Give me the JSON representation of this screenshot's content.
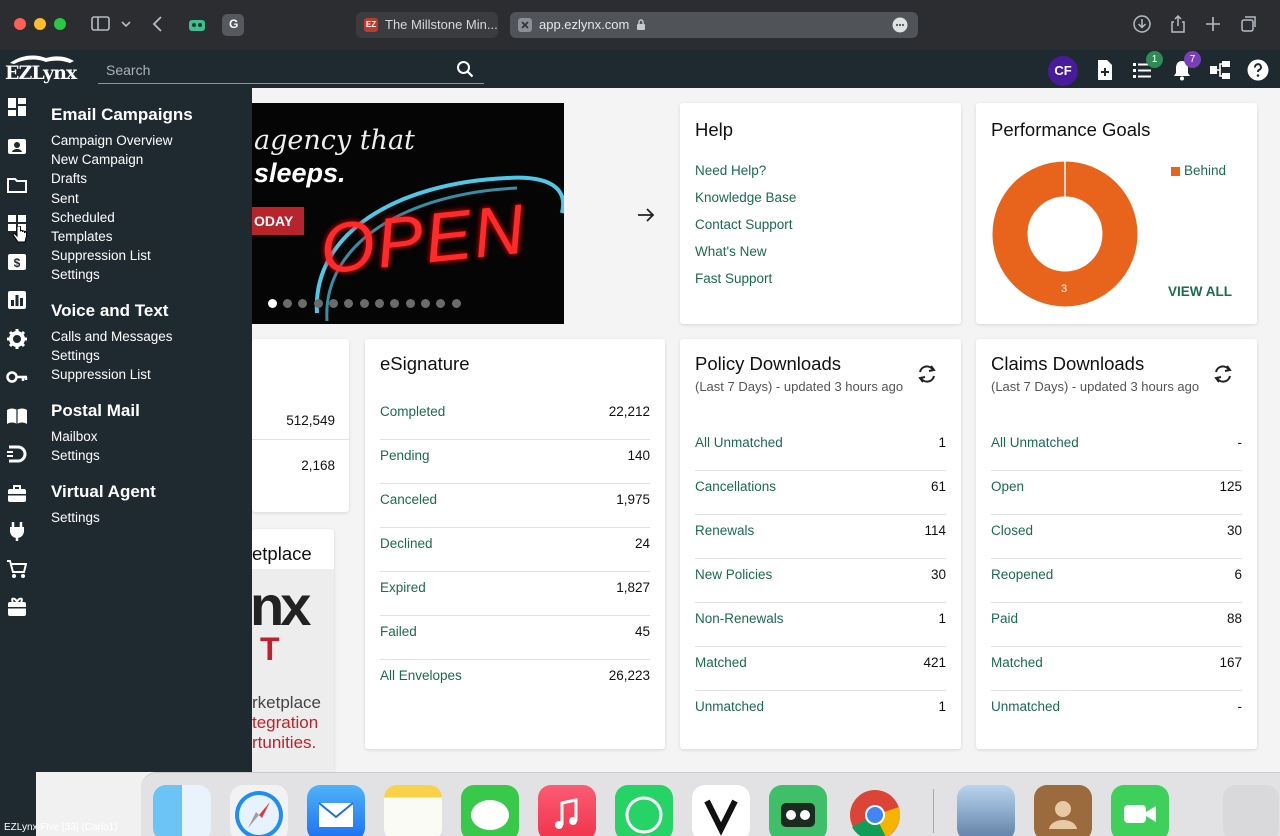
{
  "browser": {
    "tab1_title": "The Millstone Min...",
    "tab1_favicon": "EZ",
    "address": "app.ezlynx.com",
    "ext_label": "G"
  },
  "header": {
    "logo": "EZLynx",
    "search_placeholder": "Search",
    "avatar_initials": "CF",
    "list_badge": "1",
    "notif_badge": "7"
  },
  "menu": {
    "sections": [
      {
        "title": "Email Campaigns",
        "items": [
          "Campaign Overview",
          "New Campaign",
          "Drafts",
          "Sent",
          "Scheduled",
          "Templates",
          "Suppression List",
          "Settings"
        ]
      },
      {
        "title": "Voice and Text",
        "items": [
          "Calls and Messages",
          "Settings",
          "Suppression List"
        ]
      },
      {
        "title": "Postal Mail",
        "items": [
          "Mailbox",
          "Settings"
        ]
      },
      {
        "title": "Virtual Agent",
        "items": [
          "Settings"
        ]
      }
    ]
  },
  "banner": {
    "line1": "agency that",
    "line2": "sleeps.",
    "button": "ODAY",
    "neon": "OPEN"
  },
  "left_stats": {
    "values": [
      "512,549",
      "2,168"
    ],
    "marketplace_title": "etplace",
    "mp_big": "nx",
    "mp_sub": "T",
    "mp_line1": "rketplace",
    "mp_line2": "tegration",
    "mp_line3": "rtunities."
  },
  "help": {
    "title": "Help",
    "links": [
      "Need Help?",
      "Knowledge Base",
      "Contact Support",
      "What's New",
      "Fast Support"
    ]
  },
  "performance": {
    "title": "Performance Goals",
    "legend": "Behind",
    "value_label": "3",
    "view_all": "VIEW ALL",
    "color_behind": "#e8641c",
    "fraction_behind": 1.0
  },
  "esignature": {
    "title": "eSignature",
    "rows": [
      {
        "label": "Completed",
        "value": "22,212"
      },
      {
        "label": "Pending",
        "value": "140"
      },
      {
        "label": "Canceled",
        "value": "1,975"
      },
      {
        "label": "Declined",
        "value": "24"
      },
      {
        "label": "Expired",
        "value": "1,827"
      },
      {
        "label": "Failed",
        "value": "45"
      },
      {
        "label": "All Envelopes",
        "value": "26,223"
      }
    ]
  },
  "policy": {
    "title": "Policy Downloads",
    "subtitle": "(Last 7 Days) - updated 3 hours ago",
    "rows": [
      {
        "label": "All Unmatched",
        "value": "1"
      },
      {
        "label": "Cancellations",
        "value": "61"
      },
      {
        "label": "Renewals",
        "value": "114"
      },
      {
        "label": "New Policies",
        "value": "30"
      },
      {
        "label": "Non-Renewals",
        "value": "1"
      },
      {
        "label": "Matched",
        "value": "421"
      },
      {
        "label": "Unmatched",
        "value": "1"
      }
    ]
  },
  "claims": {
    "title": "Claims Downloads",
    "subtitle": "(Last 7 Days) - updated 3 hours ago",
    "rows": [
      {
        "label": "All Unmatched",
        "value": "-"
      },
      {
        "label": "Open",
        "value": "125"
      },
      {
        "label": "Closed",
        "value": "30"
      },
      {
        "label": "Reopened",
        "value": "6"
      },
      {
        "label": "Paid",
        "value": "88"
      },
      {
        "label": "Matched",
        "value": "167"
      },
      {
        "label": "Unmatched",
        "value": "-"
      }
    ]
  },
  "footer_status": "EZLynx Five [33] (Carlo1)"
}
